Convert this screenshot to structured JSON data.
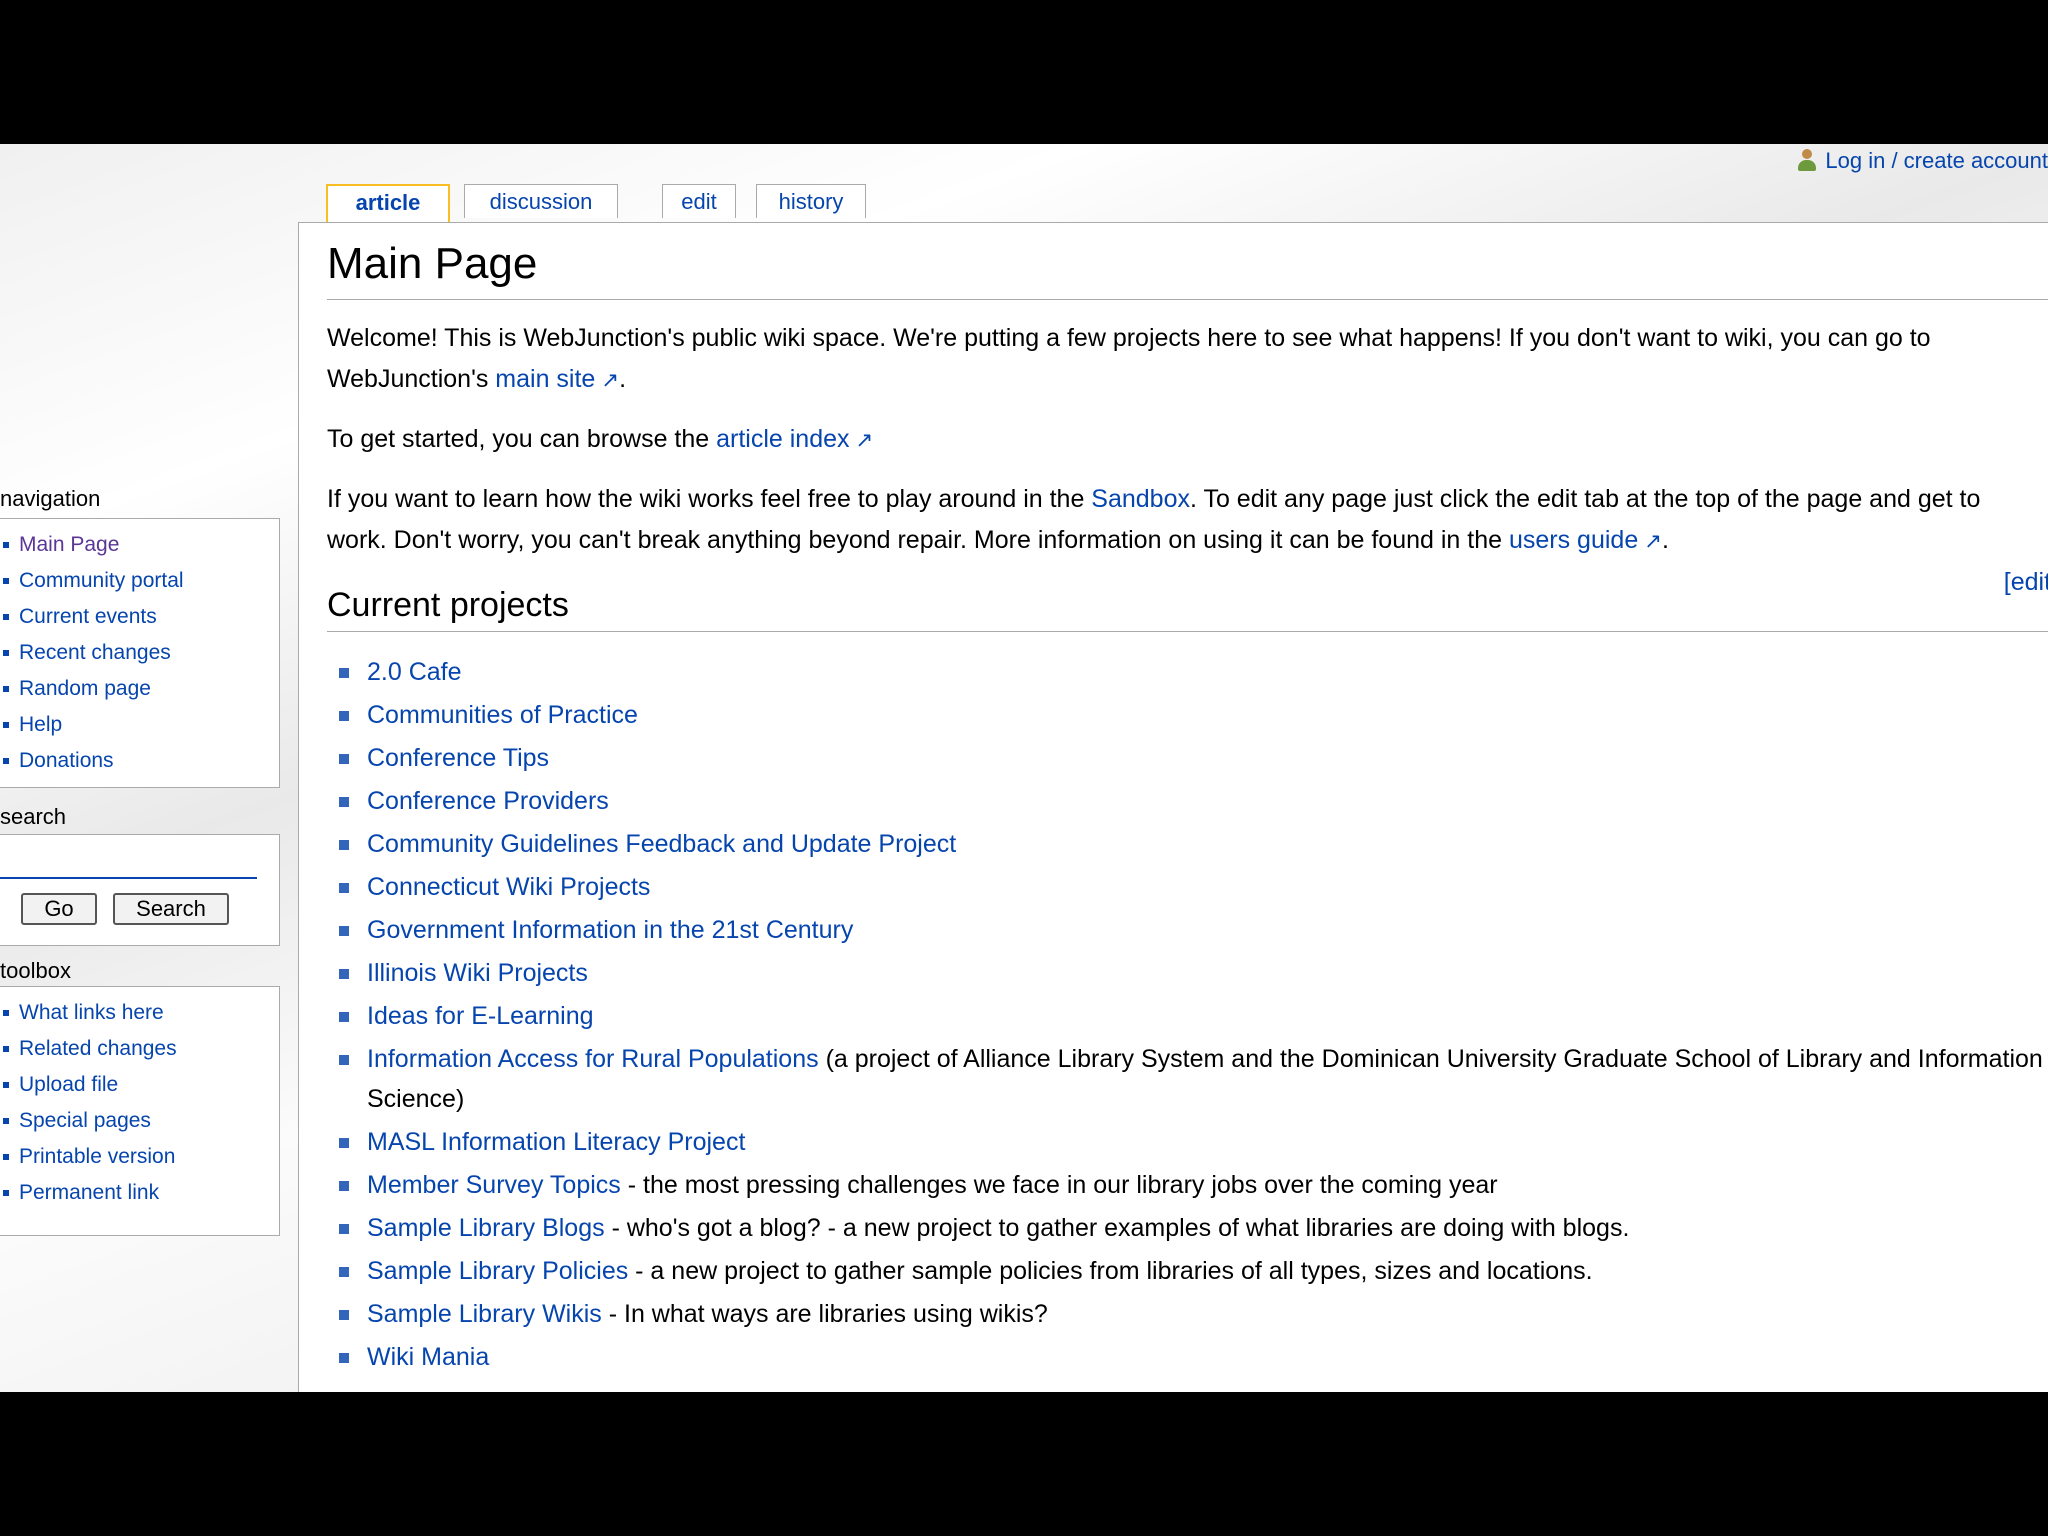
{
  "personal": {
    "login_label": "Log in / create account"
  },
  "tabs": [
    {
      "label": "article"
    },
    {
      "label": "discussion"
    },
    {
      "label": "edit"
    },
    {
      "label": "history"
    }
  ],
  "page": {
    "title": "Main Page",
    "intro": {
      "p1_before": "Welcome! This is WebJunction's public wiki space. We're putting a few projects here to see what happens! If you don't want to wiki, you can go to WebJunction's ",
      "p1_link": "main site",
      "p1_after": ".",
      "p2_before": "To get started, you can browse the ",
      "p2_link": "article index",
      "p3_before": "If you want to learn how the wiki works feel free to play around in the ",
      "p3_link1": "Sandbox",
      "p3_middle": ". To edit any page just click the edit tab at the top of the page and get to work. Don't worry, you can't break anything beyond repair. More information on using it can be found in the ",
      "p3_link2": "users guide",
      "p3_after": "."
    },
    "section_heading": "Current projects",
    "edit_label": "[edit]",
    "projects": [
      {
        "link": "2.0 Cafe",
        "desc": ""
      },
      {
        "link": "Communities of Practice",
        "desc": ""
      },
      {
        "link": "Conference Tips",
        "desc": ""
      },
      {
        "link": "Conference Providers",
        "desc": ""
      },
      {
        "link": "Community Guidelines Feedback and Update Project",
        "desc": ""
      },
      {
        "link": "Connecticut Wiki Projects",
        "desc": ""
      },
      {
        "link": "Government Information in the 21st Century",
        "desc": ""
      },
      {
        "link": "Illinois Wiki Projects",
        "desc": ""
      },
      {
        "link": "Ideas for E-Learning",
        "desc": ""
      },
      {
        "link": "Information Access for Rural Populations",
        "desc": " (a project of Alliance Library System and the Dominican University Graduate School of Library and Information Science)"
      },
      {
        "link": "MASL Information Literacy Project",
        "desc": ""
      },
      {
        "link": "Member Survey Topics",
        "desc": " - the most pressing challenges we face in our library jobs over the coming year"
      },
      {
        "link": "Sample Library Blogs",
        "desc": " - who's got a blog? - a new project to gather examples of what libraries are doing with blogs."
      },
      {
        "link": "Sample Library Policies",
        "desc": " - a new project to gather sample policies from libraries of all types, sizes and locations."
      },
      {
        "link": "Sample Library Wikis",
        "desc": " - In what ways are libraries using wikis?"
      },
      {
        "link": "Wiki Mania",
        "desc": ""
      }
    ]
  },
  "sidebar": {
    "navigation": {
      "title": "navigation",
      "items": [
        {
          "label": "Main Page"
        },
        {
          "label": "Community portal"
        },
        {
          "label": "Current events"
        },
        {
          "label": "Recent changes"
        },
        {
          "label": "Random page"
        },
        {
          "label": "Help"
        },
        {
          "label": "Donations"
        }
      ]
    },
    "search": {
      "title": "search",
      "go_label": "Go",
      "search_label": "Search"
    },
    "toolbox": {
      "title": "toolbox",
      "items": [
        {
          "label": "What links here"
        },
        {
          "label": "Related changes"
        },
        {
          "label": "Upload file"
        },
        {
          "label": "Special pages"
        },
        {
          "label": "Printable version"
        },
        {
          "label": "Permanent link"
        }
      ]
    }
  },
  "colors": {
    "link": "#0645ad",
    "tab_selected_border": "#fabd23",
    "border": "#aaaaaa",
    "visited": "#5a3696"
  }
}
